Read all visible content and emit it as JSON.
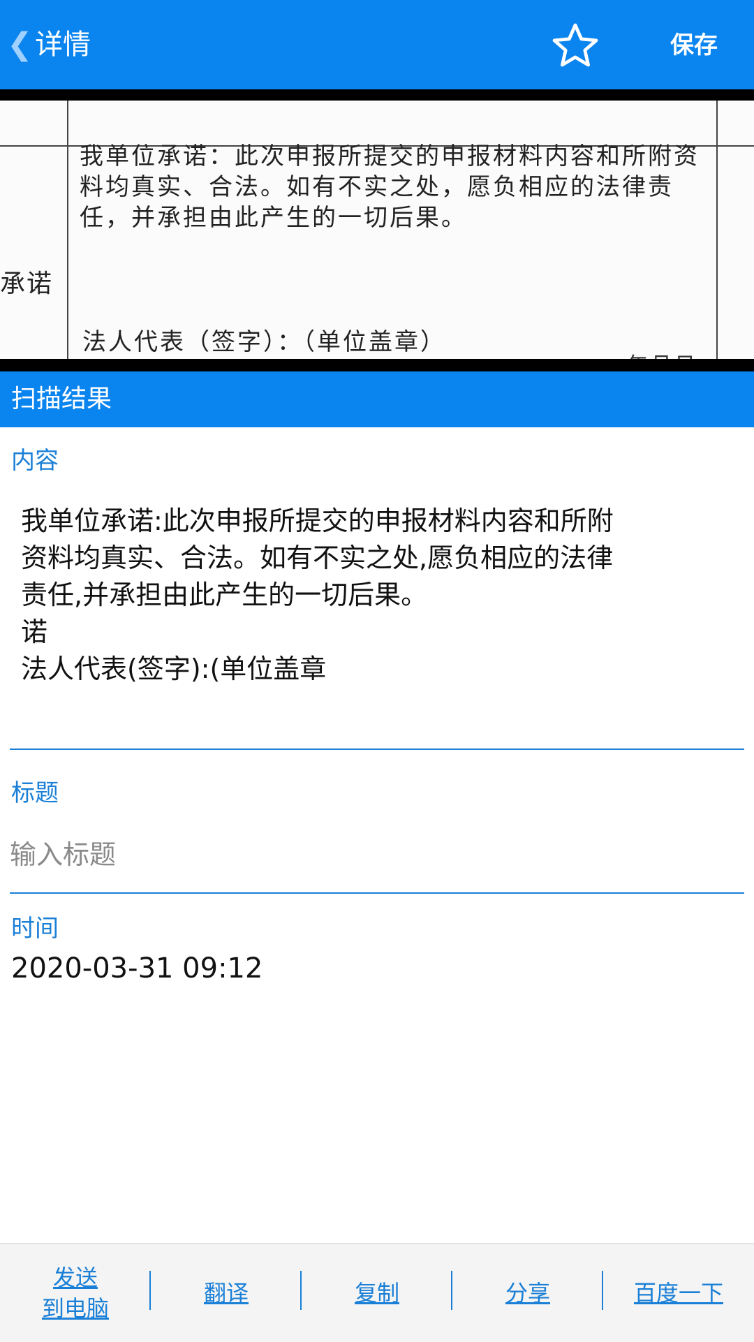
{
  "header": {
    "back_label": "详情",
    "favorite_icon": "star-outline-icon",
    "save_label": "保存"
  },
  "scan_image": {
    "side_label": "承诺",
    "text": "我单位承诺：此次申报所提交的申报材料内容和所附资料均真实、合法。如有不实之处，愿负相应的法律责任，并承担由此产生的一切后果。",
    "signature": "法人代表（签字）：（单位盖章）",
    "date_partial": "年月日"
  },
  "section": {
    "title": "扫描结果"
  },
  "content": {
    "label": "内容",
    "text": "我单位承诺:此次申报所提交的申报材料内容和所附\n资料均真实、合法。如有不实之处,愿负相应的法律\n责任,并承担由此产生的一切后果。\n诺\n法人代表(签字):(单位盖章"
  },
  "title_field": {
    "label": "标题",
    "placeholder": "输入标题",
    "value": ""
  },
  "time_field": {
    "label": "时间",
    "value": "2020-03-31 09:12"
  },
  "toolbar": {
    "send_line1": "发送",
    "send_line2": "到电脑",
    "translate": "翻译",
    "copy": "复制",
    "share": "分享",
    "baidu": "百度一下"
  },
  "colors": {
    "accent": "#0a84ee",
    "link": "#1a7fd6"
  }
}
